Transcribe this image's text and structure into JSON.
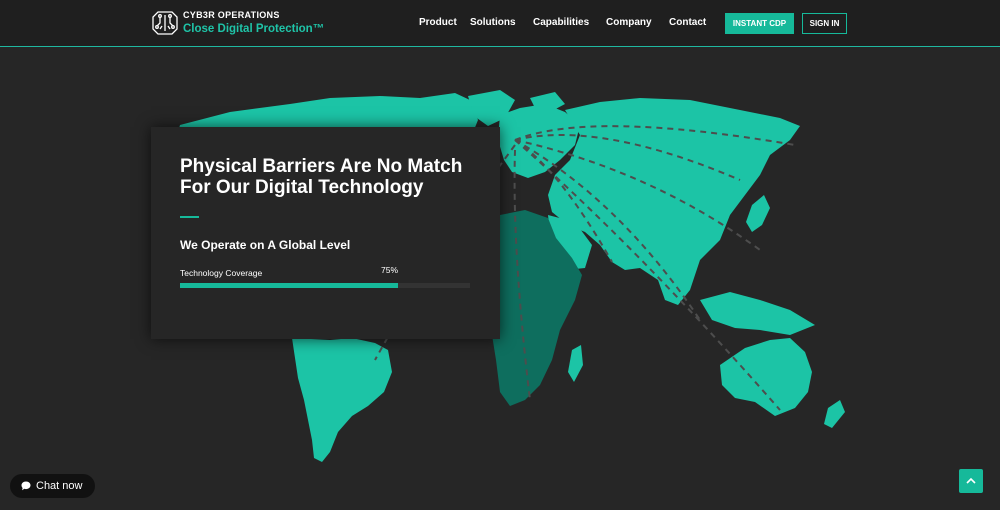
{
  "brand": {
    "name": "CYB3R OPERATIONS",
    "tagline": "Close Digital Protection™",
    "logo_icon": "circuit-brain-icon"
  },
  "nav": {
    "items": [
      {
        "label": "Product"
      },
      {
        "label": "Solutions"
      },
      {
        "label": "Capabilities"
      },
      {
        "label": "Company"
      },
      {
        "label": "Contact"
      }
    ],
    "cta_label": "INSTANT CDP",
    "signin_label": "SIGN IN"
  },
  "hero": {
    "title": "Physical Barriers Are No Match For Our Digital Technology",
    "subtitle": "We Operate on A Global Level",
    "progress": {
      "label": "Technology Coverage",
      "value_text": "75%",
      "value": 0.75
    }
  },
  "chat": {
    "label": "Chat now",
    "icon": "chat-bubble-icon"
  },
  "scroll_top": {
    "icon": "chevron-up-icon"
  },
  "colors": {
    "accent": "#16b99a",
    "map_land": "#1cc4a6",
    "map_africa": "#0e6e5e",
    "background": "#262626",
    "header": "#1f1f1f",
    "route_lines": "#4d4d4d"
  }
}
